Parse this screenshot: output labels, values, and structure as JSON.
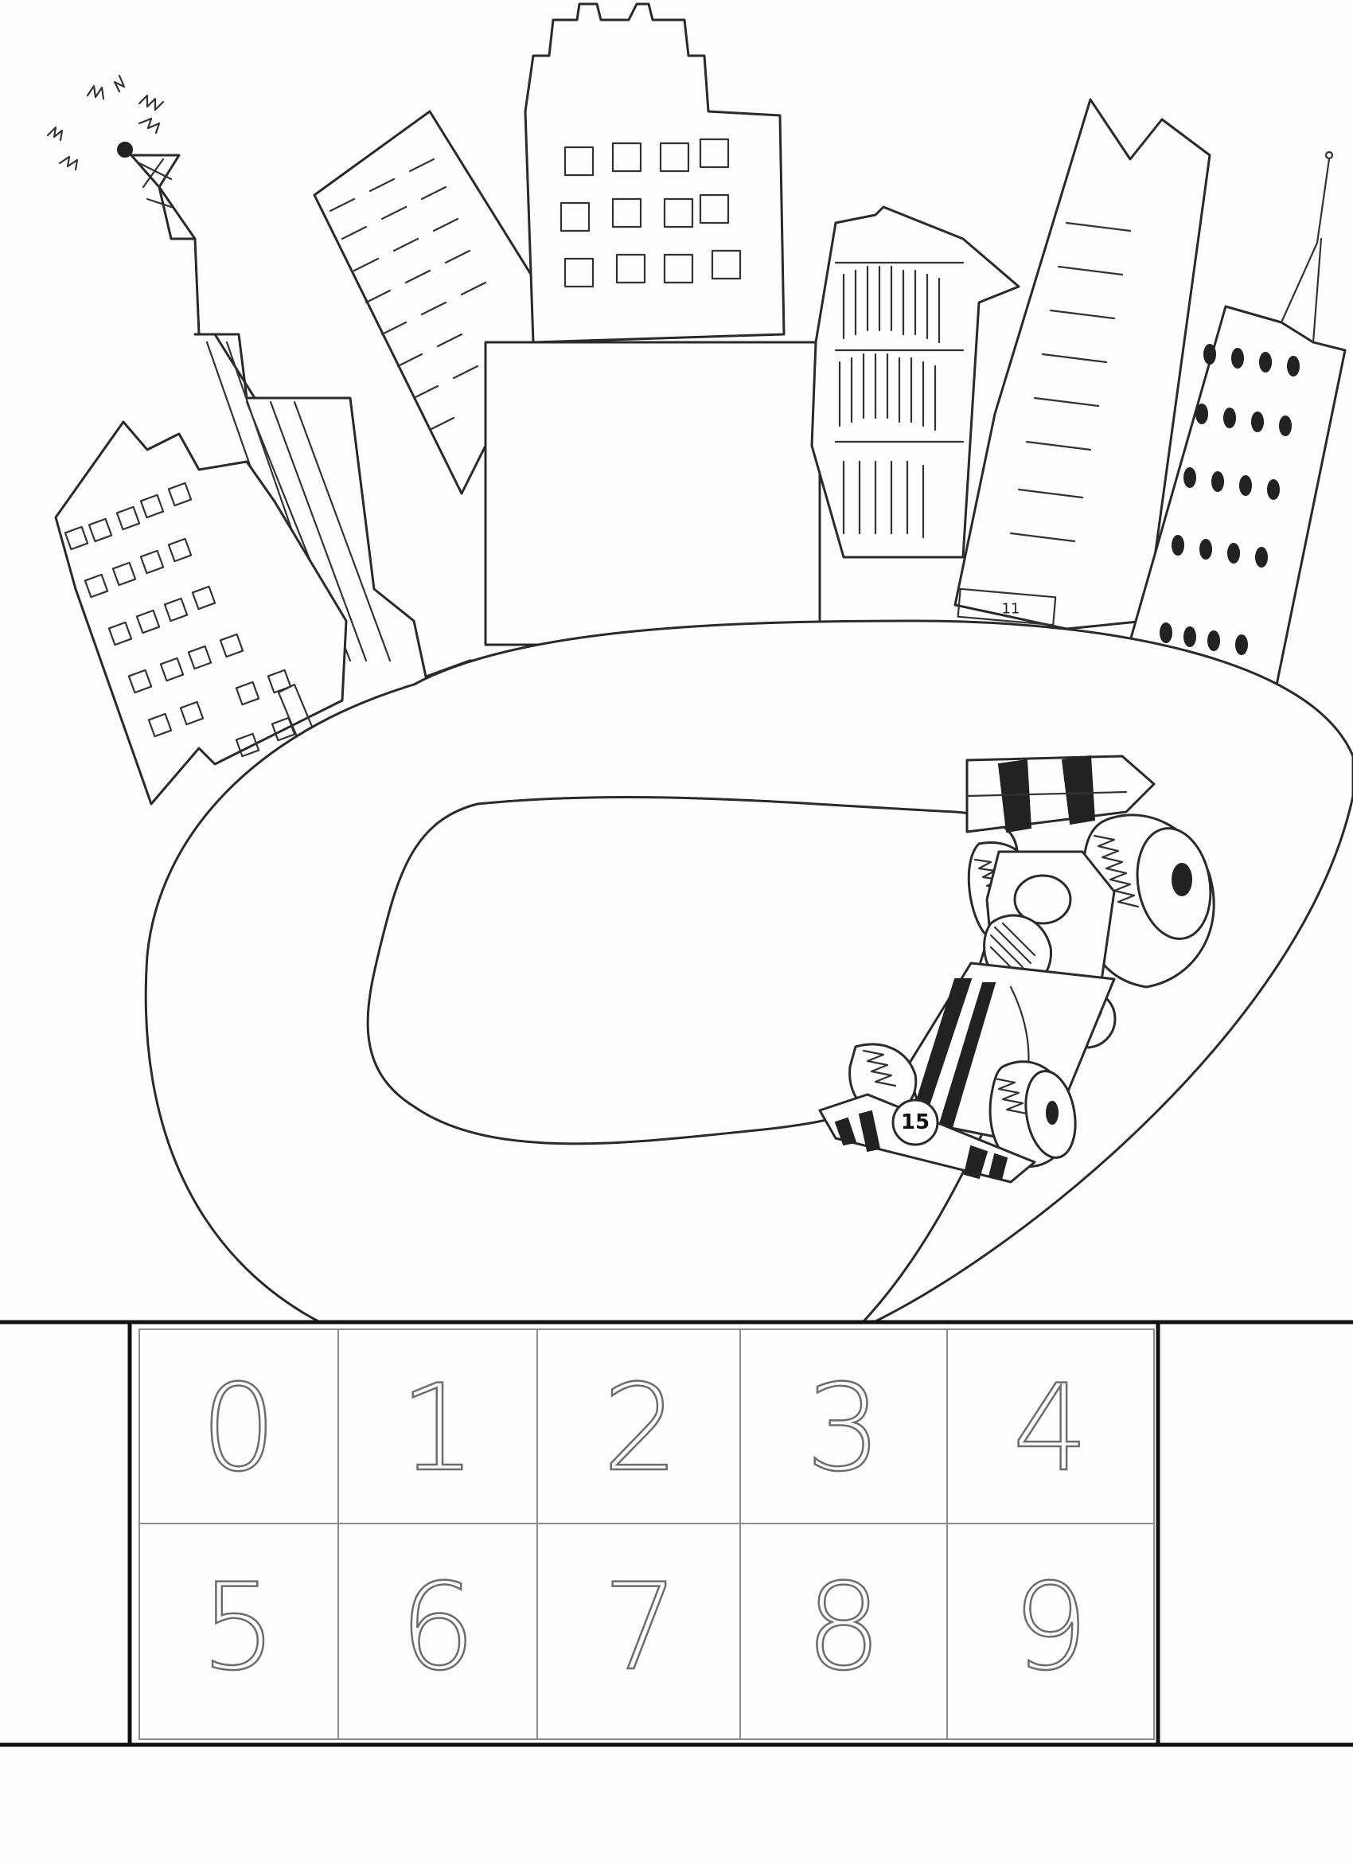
{
  "car": {
    "number_hood": "15",
    "number_nose": "15"
  },
  "building_sign": {
    "text": "11"
  },
  "digits_grid": {
    "row1": [
      "0",
      "1",
      "2",
      "3",
      "4"
    ],
    "row2": [
      "5",
      "6",
      "7",
      "8",
      "9"
    ]
  },
  "colors": {
    "ink": "#2a2a2a",
    "digit_pencil": "#6d6d6d",
    "frame": "#111111",
    "paper": "#fdfdfd"
  }
}
